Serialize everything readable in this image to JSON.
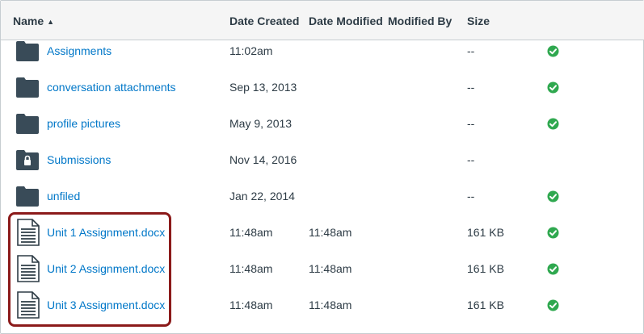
{
  "columns": {
    "name": "Name",
    "date_created": "Date Created",
    "date_modified": "Date Modified",
    "modified_by": "Modified By",
    "size": "Size"
  },
  "sort_indicator": "▲",
  "rows": [
    {
      "name": "Assignments",
      "type": "folder",
      "created": "11:02am",
      "modified": "",
      "modified_by": "",
      "size": "--",
      "published": true
    },
    {
      "name": "conversation attachments",
      "type": "folder",
      "created": "Sep 13, 2013",
      "modified": "",
      "modified_by": "",
      "size": "--",
      "published": true
    },
    {
      "name": "profile pictures",
      "type": "folder",
      "created": "May 9, 2013",
      "modified": "",
      "modified_by": "",
      "size": "--",
      "published": true
    },
    {
      "name": "Submissions",
      "type": "locked-folder",
      "created": "Nov 14, 2016",
      "modified": "",
      "modified_by": "",
      "size": "--",
      "published": false
    },
    {
      "name": "unfiled",
      "type": "folder",
      "created": "Jan 22, 2014",
      "modified": "",
      "modified_by": "",
      "size": "--",
      "published": true
    },
    {
      "name": "Unit 1 Assignment.docx",
      "type": "document",
      "created": "11:48am",
      "modified": "11:48am",
      "modified_by": "",
      "size": "161 KB",
      "published": true
    },
    {
      "name": "Unit 2 Assignment.docx",
      "type": "document",
      "created": "11:48am",
      "modified": "11:48am",
      "modified_by": "",
      "size": "161 KB",
      "published": true
    },
    {
      "name": "Unit 3 Assignment.docx",
      "type": "document",
      "created": "11:48am",
      "modified": "11:48am",
      "modified_by": "",
      "size": "161 KB",
      "published": true
    }
  ],
  "colors": {
    "link": "#0077c8",
    "text": "#2d3b45",
    "folder": "#394b58",
    "published": "#2fa84f",
    "highlight": "#8b1a1a"
  }
}
